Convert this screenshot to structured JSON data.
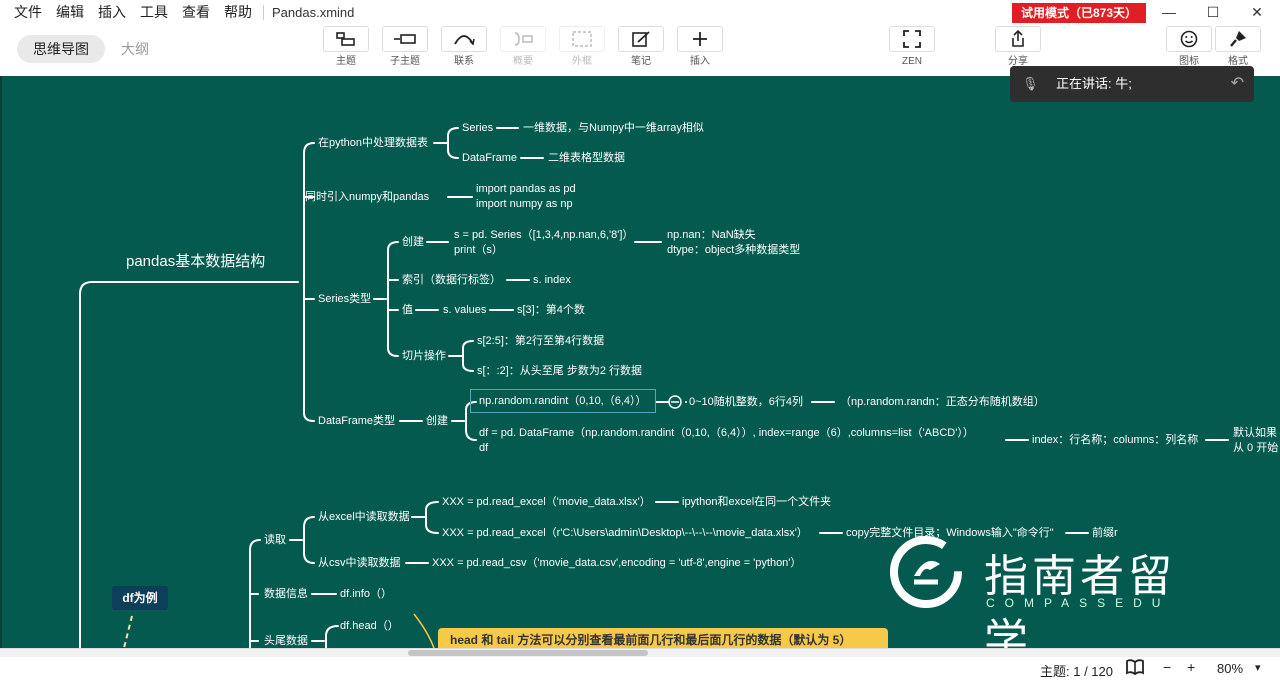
{
  "menu": {
    "items": [
      "文件",
      "编辑",
      "插入",
      "工具",
      "查看",
      "帮助"
    ],
    "doc_title": "Pandas.xmind"
  },
  "trial_badge": "试用模式（已873天）",
  "views": {
    "mindmap": "思维导图",
    "outline": "大纲"
  },
  "tools": {
    "topic": "主题",
    "subtopic": "子主题",
    "relation": "联系",
    "summary": "概要",
    "boundary": "外框",
    "note": "笔记",
    "insert": "插入",
    "zen": "ZEN",
    "share": "分享",
    "icon": "图标",
    "format": "格式"
  },
  "speech": {
    "text": "正在讲话: 牛;"
  },
  "mindmap": {
    "root": "pandas基本数据结构",
    "b1": "在python中处理数据表",
    "b1_series": "Series",
    "b1_series_desc": "一维数据，与Numpy中一维array相似",
    "b1_df": "DataFrame",
    "b1_df_desc": "二维表格型数据",
    "b2": "同时引入numpy和pandas",
    "b2_line1": "import pandas as pd",
    "b2_line2": "import numpy as np",
    "b3": "Series类型",
    "b3_create": "创建",
    "b3_create_code1": "s = pd. Series（[1,3,4,np.nan,6,'8']）",
    "b3_create_code2": "print（s）",
    "b3_nan1": "np.nan：NaN缺失",
    "b3_nan2": "dtype：object多种数据类型",
    "b3_index": "索引（数据行标签）",
    "b3_index_val": "s. index",
    "b3_value": "值",
    "b3_value_code": "s. values",
    "b3_value_desc": "s[3]：第4个数",
    "b3_slice": "切片操作",
    "b3_slice1": "s[2:5]：第2行至第4行数据",
    "b3_slice2": "s[：:2]：从头至尾 步数为2 行数据",
    "b4": "DataFrame类型",
    "b4_create": "创建",
    "b4_randint": "np.random.randint（0,10,（6,4））",
    "b4_randint_desc": "0~10随机整数，6行4列",
    "b4_randn": "（np.random.randn：正态分布随机数组）",
    "b4_df_code1": "df = pd. DataFrame（np.random.randint（0,10,（6,4））, index=range（6）,columns=list（'ABCD'））",
    "b4_df_code2": "df",
    "b4_df_desc": "index：行名称；columns：列名称",
    "b4_df_cut1": "默认如果",
    "b4_df_cut2": "从 0 开始",
    "r1": "读取",
    "r1_excel": "从excel中读取数据",
    "r1_excel_code1": "XXX = pd.read_excel（'movie_data.xlsx'）",
    "r1_excel_desc1": "ipython和excel在同一个文件夹",
    "r1_excel_code2": "XXX = pd.read_excel（r'C:\\Users\\admin\\Desktop\\--\\--\\--\\movie_data.xlsx'）",
    "r1_excel_desc2": "copy完整文件目录；Windows输入\"命令行\"",
    "r1_excel_desc2b": "前缀r",
    "r1_csv": "从csv中读取数据",
    "r1_csv_code": "XXX = pd.read_csv（'movie_data.csv',encoding = 'utf-8',engine = 'python'）",
    "r2": "数据信息",
    "r2_code": "df.info（）",
    "r3": "头尾数据",
    "r3_code": "df.head（）",
    "df_badge": "df为例",
    "note": "head 和 tail 方法可以分别查看最前面几行和最后面几行的数据（默认为 5）"
  },
  "watermark": {
    "cn": "指南者留学",
    "en": "COMPASSEDU"
  },
  "status": {
    "topics": "主题: 1 / 120",
    "zoom": "80%",
    "minus": "−",
    "plus": "+"
  },
  "colors": {
    "canvas": "#045a4f",
    "trial": "#e01e24",
    "note": "#f7c948",
    "badge": "#0e3f5a"
  }
}
